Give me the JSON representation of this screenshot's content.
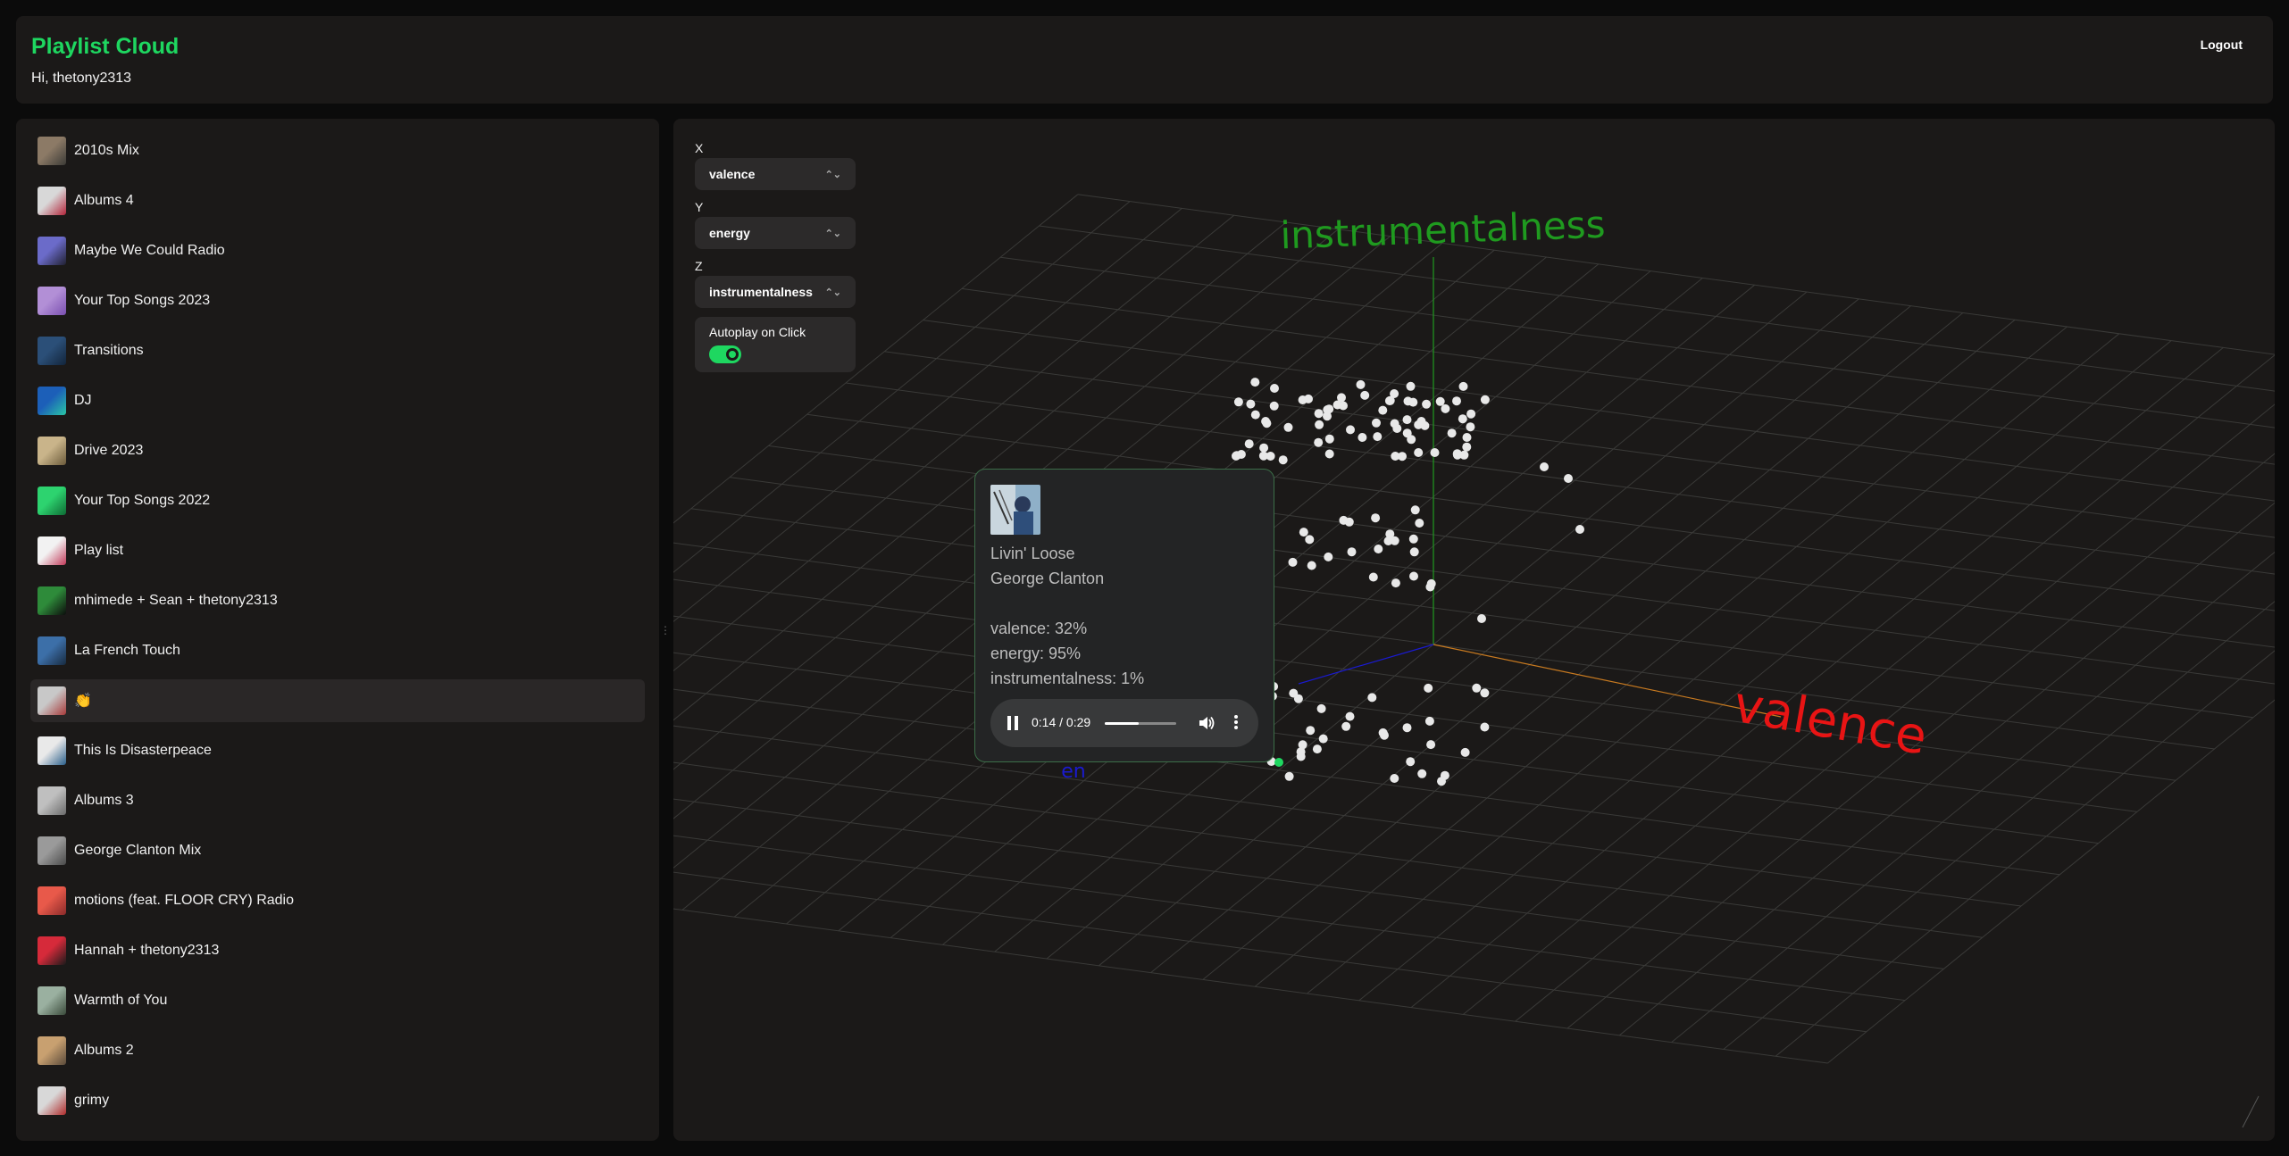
{
  "app": {
    "title": "Playlist Cloud",
    "greeting": "Hi, thetony2313",
    "logout_label": "Logout"
  },
  "playlists": [
    {
      "name": "2010s Mix",
      "thumb": [
        "#8c7a66",
        "#3b3a36"
      ]
    },
    {
      "name": "Albums 4",
      "thumb": [
        "#d8d8d8",
        "#b3243a"
      ]
    },
    {
      "name": "Maybe We Could Radio",
      "thumb": [
        "#6b6bc9",
        "#202030"
      ]
    },
    {
      "name": "Your Top Songs 2023",
      "thumb": [
        "#b28fd6",
        "#7a4fb0"
      ]
    },
    {
      "name": "Transitions",
      "thumb": [
        "#2b4f78",
        "#12243a"
      ]
    },
    {
      "name": "DJ",
      "thumb": [
        "#1c5fb8",
        "#2ac7a6"
      ]
    },
    {
      "name": "Drive 2023",
      "thumb": [
        "#c9b48a",
        "#6b5a3a"
      ]
    },
    {
      "name": "Your Top Songs 2022",
      "thumb": [
        "#2dd36f",
        "#0e6b34"
      ]
    },
    {
      "name": "Play list",
      "thumb": [
        "#f2f2f2",
        "#c23a5a"
      ]
    },
    {
      "name": "mhimede + Sean + thetony2313",
      "thumb": [
        "#2e8b3a",
        "#0c0c0c"
      ]
    },
    {
      "name": "La French Touch",
      "thumb": [
        "#3c6fa8",
        "#182a3f"
      ]
    },
    {
      "name": "👏",
      "thumb": [
        "#c8c8c8",
        "#a83a3a"
      ]
    },
    {
      "name": "This Is Disasterpeace",
      "thumb": [
        "#e9e9e9",
        "#2a5e8a"
      ]
    },
    {
      "name": "Albums 3",
      "thumb": [
        "#bfbfbf",
        "#6a6a6a"
      ]
    },
    {
      "name": "George Clanton Mix",
      "thumb": [
        "#9a9a9a",
        "#4a4a4a"
      ]
    },
    {
      "name": "motions (feat. FLOOR CRY) Radio",
      "thumb": [
        "#e8594a",
        "#8a2a2a"
      ]
    },
    {
      "name": "Hannah + thetony2313",
      "thumb": [
        "#d62a3a",
        "#1a1a1a"
      ]
    },
    {
      "name": "Warmth of You",
      "thumb": [
        "#9ab0a0",
        "#3a4a3a"
      ]
    },
    {
      "name": "Albums 2",
      "thumb": [
        "#c8a070",
        "#5a4a3a"
      ]
    },
    {
      "name": "grimy",
      "thumb": [
        "#d8d8d8",
        "#b02a2a"
      ]
    }
  ],
  "active_playlist_index": 11,
  "controls": {
    "x_label": "X",
    "x_value": "valence",
    "y_label": "Y",
    "y_value": "energy",
    "z_label": "Z",
    "z_value": "instrumentalness",
    "autoplay_label": "Autoplay on Click",
    "autoplay_on": true
  },
  "plot": {
    "z_axis_label": "instrumentalness",
    "x_axis_label": "valence",
    "y_axis_label": "en",
    "z_color": "#1f9a1f",
    "x_color": "#e81414",
    "y_color": "#1a1ad0",
    "point_color": "#e8e8e8",
    "selected_point_color": "#1ed760"
  },
  "track_popup": {
    "title": "Livin' Loose",
    "artist": "George Clanton",
    "valence_text": "valence: 32%",
    "energy_text": "energy: 95%",
    "instrumentalness_text": "instrumentalness: 1%",
    "time_text": "0:14 / 0:29",
    "progress": 0.48
  },
  "colors": {
    "accent": "#1ed760",
    "panel": "#1b1918",
    "background": "#0b0b0b"
  }
}
